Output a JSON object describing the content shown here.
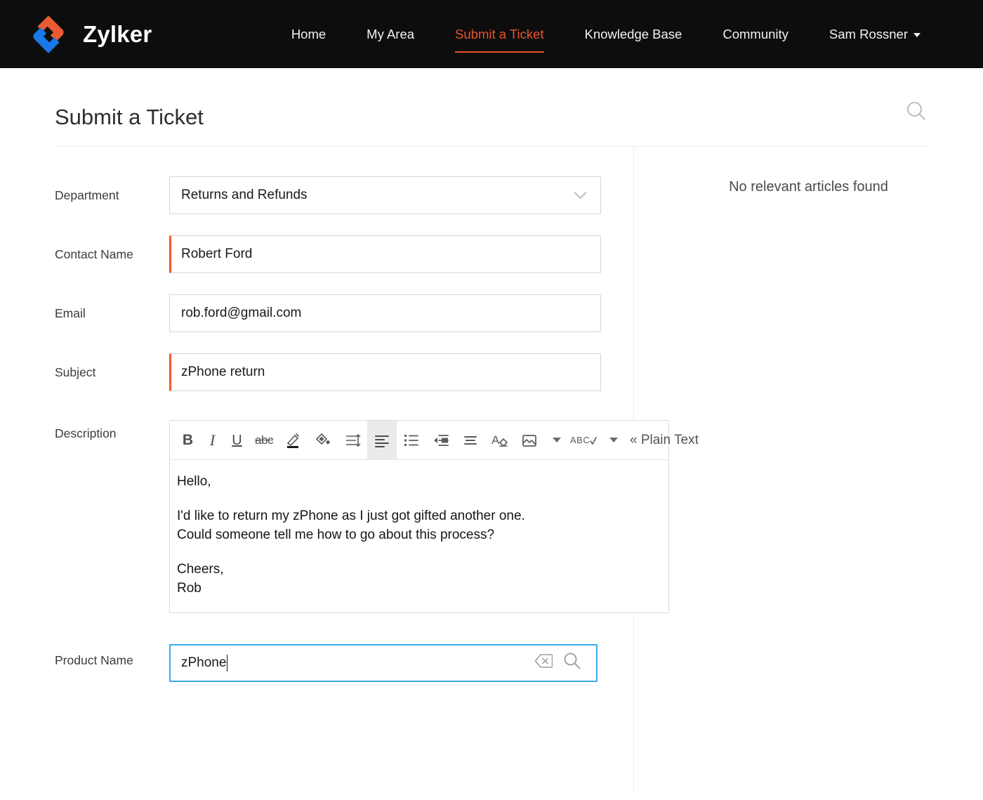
{
  "brand": {
    "name": "Zylker",
    "logo_icon": "zylker-diamond-logo",
    "orange": "#e8542b",
    "blue": "#1a73e8"
  },
  "nav": {
    "items": [
      {
        "label": "Home",
        "active": false
      },
      {
        "label": "My Area",
        "active": false
      },
      {
        "label": "Submit a Ticket",
        "active": true
      },
      {
        "label": "Knowledge Base",
        "active": false
      },
      {
        "label": "Community",
        "active": false
      },
      {
        "label": "Sam Rossner",
        "active": false,
        "has_caret": true
      }
    ]
  },
  "page": {
    "title": "Submit a Ticket",
    "search_icon": "search-icon"
  },
  "form": {
    "department": {
      "label": "Department",
      "value": "Returns and Refunds",
      "dropdown_icon": "chevron-down-icon",
      "required": false
    },
    "contact_name": {
      "label": "Contact Name",
      "value": "Robert Ford",
      "required": true
    },
    "email": {
      "label": "Email",
      "value": "rob.ford@gmail.com",
      "required": false
    },
    "subject": {
      "label": "Subject",
      "value": "zPhone return",
      "required": true
    },
    "description": {
      "label": "Description",
      "toolbar": [
        {
          "name": "bold-icon",
          "glyph": "B"
        },
        {
          "name": "italic-icon",
          "glyph": "I"
        },
        {
          "name": "underline-icon",
          "glyph": "U"
        },
        {
          "name": "strikethrough-icon",
          "glyph": "abc"
        },
        {
          "name": "font-color-icon",
          "glyph": ""
        },
        {
          "name": "background-color-icon",
          "glyph": ""
        },
        {
          "name": "line-spacing-icon",
          "glyph": ""
        },
        {
          "name": "align-left-icon",
          "glyph": "",
          "active": true
        },
        {
          "name": "bulleted-list-icon",
          "glyph": ""
        },
        {
          "name": "indent-icon",
          "glyph": ""
        },
        {
          "name": "align-justify-icon",
          "glyph": ""
        },
        {
          "name": "clear-formatting-icon",
          "glyph": ""
        },
        {
          "name": "insert-image-icon",
          "glyph": ""
        },
        {
          "name": "more-options-caret-icon",
          "glyph": ""
        },
        {
          "name": "spellcheck-icon",
          "glyph": "ABC"
        },
        {
          "name": "spellcheck-caret-icon",
          "glyph": ""
        }
      ],
      "plain_text_link": "« Plain Text",
      "body": {
        "greeting": "Hello,",
        "line1": "I'd like to return my zPhone as I just got gifted another one.",
        "line2": "Could someone tell me how to go about  this process?",
        "signoff": "Cheers,",
        "name": "Rob"
      }
    },
    "product_name": {
      "label": "Product Name",
      "value": "zPhone",
      "required": false,
      "focused": true,
      "clear_icon": "clear-backspace-icon",
      "search_icon": "lookup-search-icon"
    }
  },
  "sidebar": {
    "empty_message": "No relevant articles found"
  }
}
